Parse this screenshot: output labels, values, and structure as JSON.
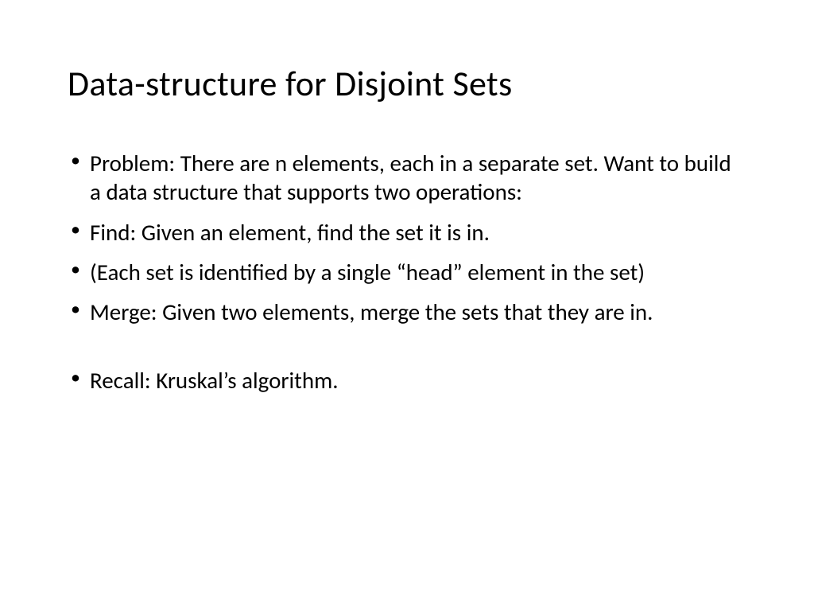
{
  "slide": {
    "title": "Data-structure for Disjoint Sets",
    "bullets": [
      "Problem: There are n elements, each in a separate set. Want to build a data structure that supports two operations:",
      "Find: Given an element, find the set it is in.",
      "(Each set is identified by a single “head” element in the set)",
      "Merge: Given two elements, merge the sets that they are in.",
      "Recall: Kruskal’s algorithm."
    ]
  }
}
